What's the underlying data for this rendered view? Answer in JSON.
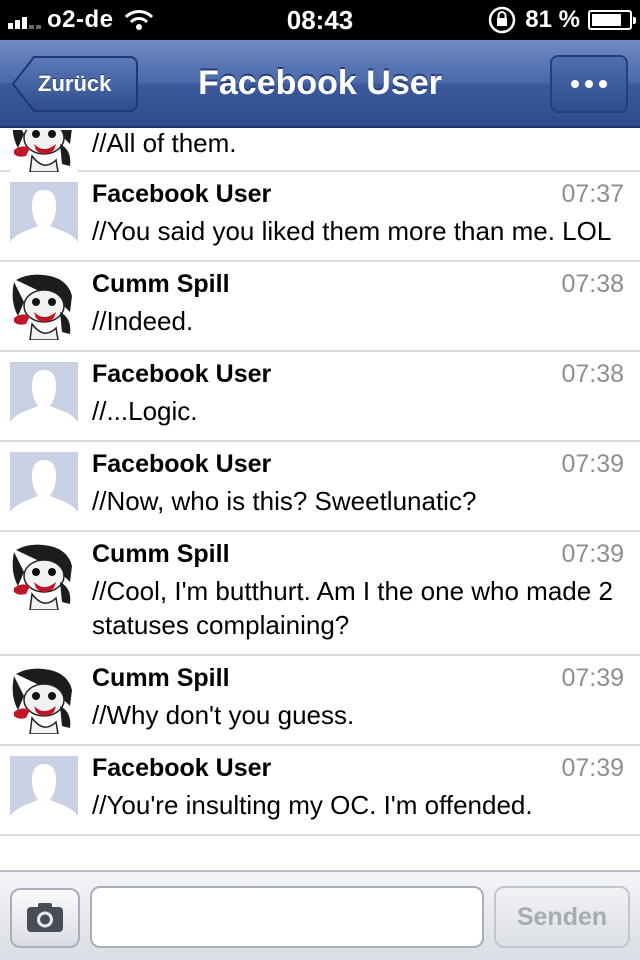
{
  "status_bar": {
    "carrier": "o2-de",
    "time": "08:43",
    "battery_percent": "81 %",
    "battery_level": 0.81,
    "icons": [
      "signal-icon",
      "wifi-icon",
      "rotation-lock-icon",
      "battery-icon"
    ]
  },
  "nav": {
    "back_label": "Zurück",
    "title": "Facebook User",
    "more_icon": "ellipsis-icon",
    "color": "#3c5a9b"
  },
  "messages": [
    {
      "sender": "",
      "time": "",
      "text": "//All of them.",
      "avatar": "oc-avatar",
      "partial": true
    },
    {
      "sender": "Facebook User",
      "time": "07:37",
      "text": "//You said you liked them more than me. LOL",
      "avatar": "default-avatar"
    },
    {
      "sender": "Cumm Spill",
      "time": "07:38",
      "text": "//Indeed.",
      "avatar": "oc-avatar"
    },
    {
      "sender": "Facebook User",
      "time": "07:38",
      "text": "//...Logic.",
      "avatar": "default-avatar"
    },
    {
      "sender": "Facebook User",
      "time": "07:39",
      "text": "//Now, who is this? Sweetlunatic?",
      "avatar": "default-avatar"
    },
    {
      "sender": "Cumm Spill",
      "time": "07:39",
      "text": "//Cool, I'm butthurt. Am I the one who made 2 statuses complaining?",
      "avatar": "oc-avatar"
    },
    {
      "sender": "Cumm Spill",
      "time": "07:39",
      "text": "//Why don't you guess.",
      "avatar": "oc-avatar"
    },
    {
      "sender": "Facebook User",
      "time": "07:39",
      "text": "//You're insulting my OC. I'm offended.",
      "avatar": "default-avatar"
    }
  ],
  "composer": {
    "camera_icon": "camera-icon",
    "input_value": "",
    "send_label": "Senden"
  }
}
